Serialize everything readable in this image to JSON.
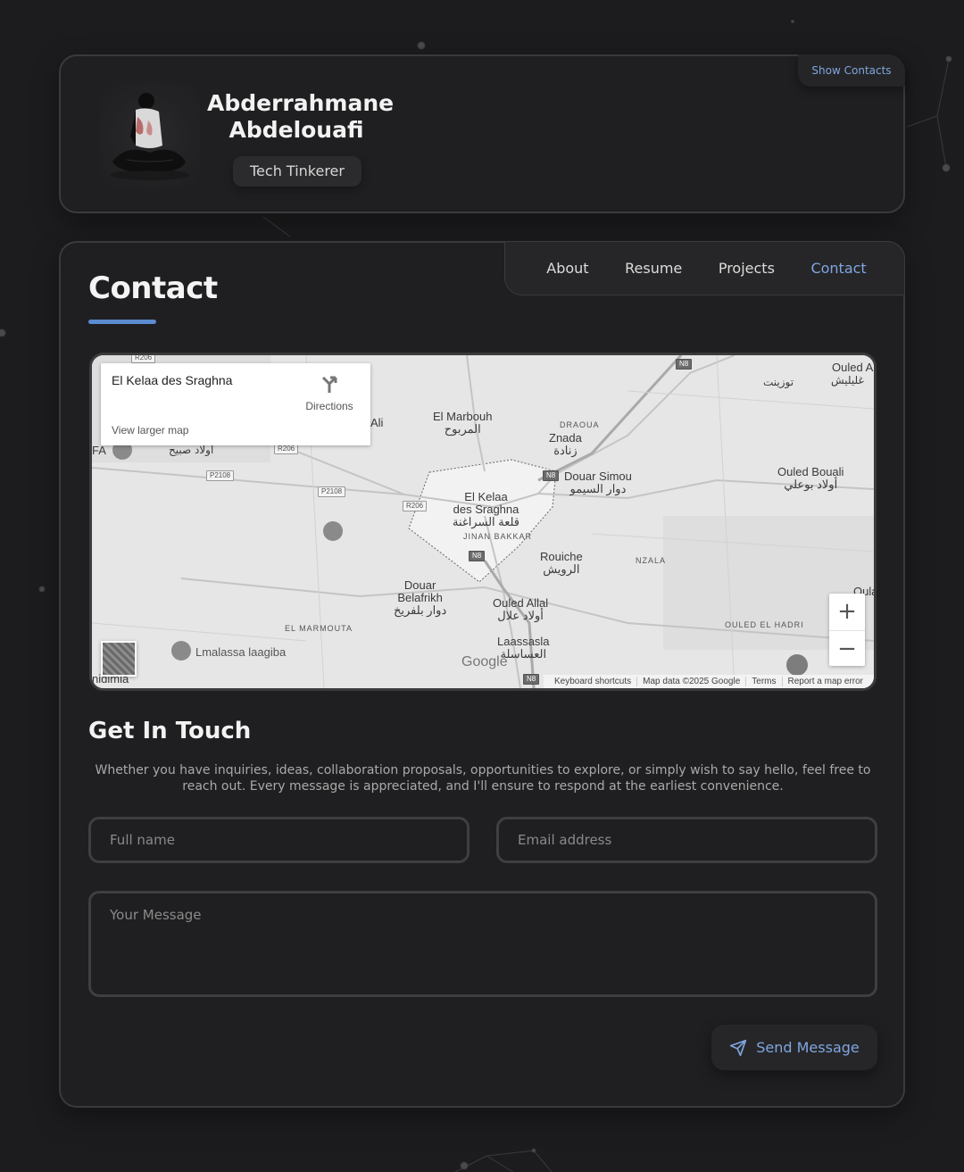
{
  "profile": {
    "name_line1": "Abderrahmane",
    "name_line2": "Abdelouafi",
    "title": "Tech Tinkerer",
    "show_contacts_label": "Show Contacts"
  },
  "nav": {
    "items": [
      {
        "label": "About",
        "active": false
      },
      {
        "label": "Resume",
        "active": false
      },
      {
        "label": "Projects",
        "active": false
      },
      {
        "label": "Contact",
        "active": true
      }
    ]
  },
  "page": {
    "title": "Contact"
  },
  "map": {
    "place_name": "El Kelaa des Sraghna",
    "directions_label": "Directions",
    "larger_map_label": "View larger map",
    "zoom_in": "+",
    "zoom_out": "−",
    "google": "Google",
    "footer": [
      "Keyboard shortcuts",
      "Map data ©2025 Google",
      "Terms",
      "Report a map error"
    ],
    "labels": {
      "elmarbouh": "El Marbouh",
      "elmarbouh_ar": "المربوح",
      "znada": "Znada",
      "znada_ar": "زنادة",
      "douarsimou": "Douar Simou",
      "douarsimou_ar": "دوار السيمو",
      "ouledbouali": "Ouled Bouali",
      "ouledbouali_ar": "أولاد بوعلي",
      "kelaa1": "El Kelaa",
      "kelaa2": "des Sraghna",
      "kelaa_ar": "قلعة السراغنة",
      "jinan": "JINAN BAKKAR",
      "rouiche": "Rouiche",
      "rouiche_ar": "الرويش",
      "nzala": "NZALA",
      "douarbelafrikh1": "Douar",
      "douarbelafrikh2": "Belafrikh",
      "douarbelafrikh_ar": "دوار بلفريخ",
      "ouledallal": "Ouled Allal",
      "ouledallal_ar": "أولاد علال",
      "laassasla": "Laassasla",
      "laassasla_ar": "العساسلة",
      "elmarmouta": "EL MARMOUTA",
      "ouledelhadri": "OULED EL HADRI",
      "lmalassa": "Lmalassa laagiba",
      "ouled_top": "Ouled A",
      "ali": "Ali",
      "ouled_sbih_ar": "أولاد صبيح",
      "ouled_top_ar": "غليليش",
      "tourzint_ar": "توزينت",
      "draoua": "DRAOUA",
      "fa": "FA",
      "nidimia": "nidimia",
      "oula": "Oula"
    },
    "shields": {
      "r206a": "R206",
      "r206b": "R206",
      "r206c": "R206",
      "p2108a": "P2108",
      "p2108b": "P2108",
      "n8a": "N8",
      "n8b": "N8",
      "n8c": "N8",
      "n8d": "N8"
    }
  },
  "contact": {
    "section_title": "Get In Touch",
    "intro": "Whether you have inquiries, ideas, collaboration proposals, opportunities to explore, or simply wish to say hello, feel free to reach out. Every message is appreciated, and I'll ensure to respond at the earliest convenience.",
    "name_placeholder": "Full name",
    "email_placeholder": "Email address",
    "message_placeholder": "Your Message",
    "send_label": "Send Message"
  },
  "colors": {
    "accent": "#7fa6e0",
    "underline": "#5b8bd0",
    "background": "#1c1c1e",
    "card": "#1f1f21"
  }
}
